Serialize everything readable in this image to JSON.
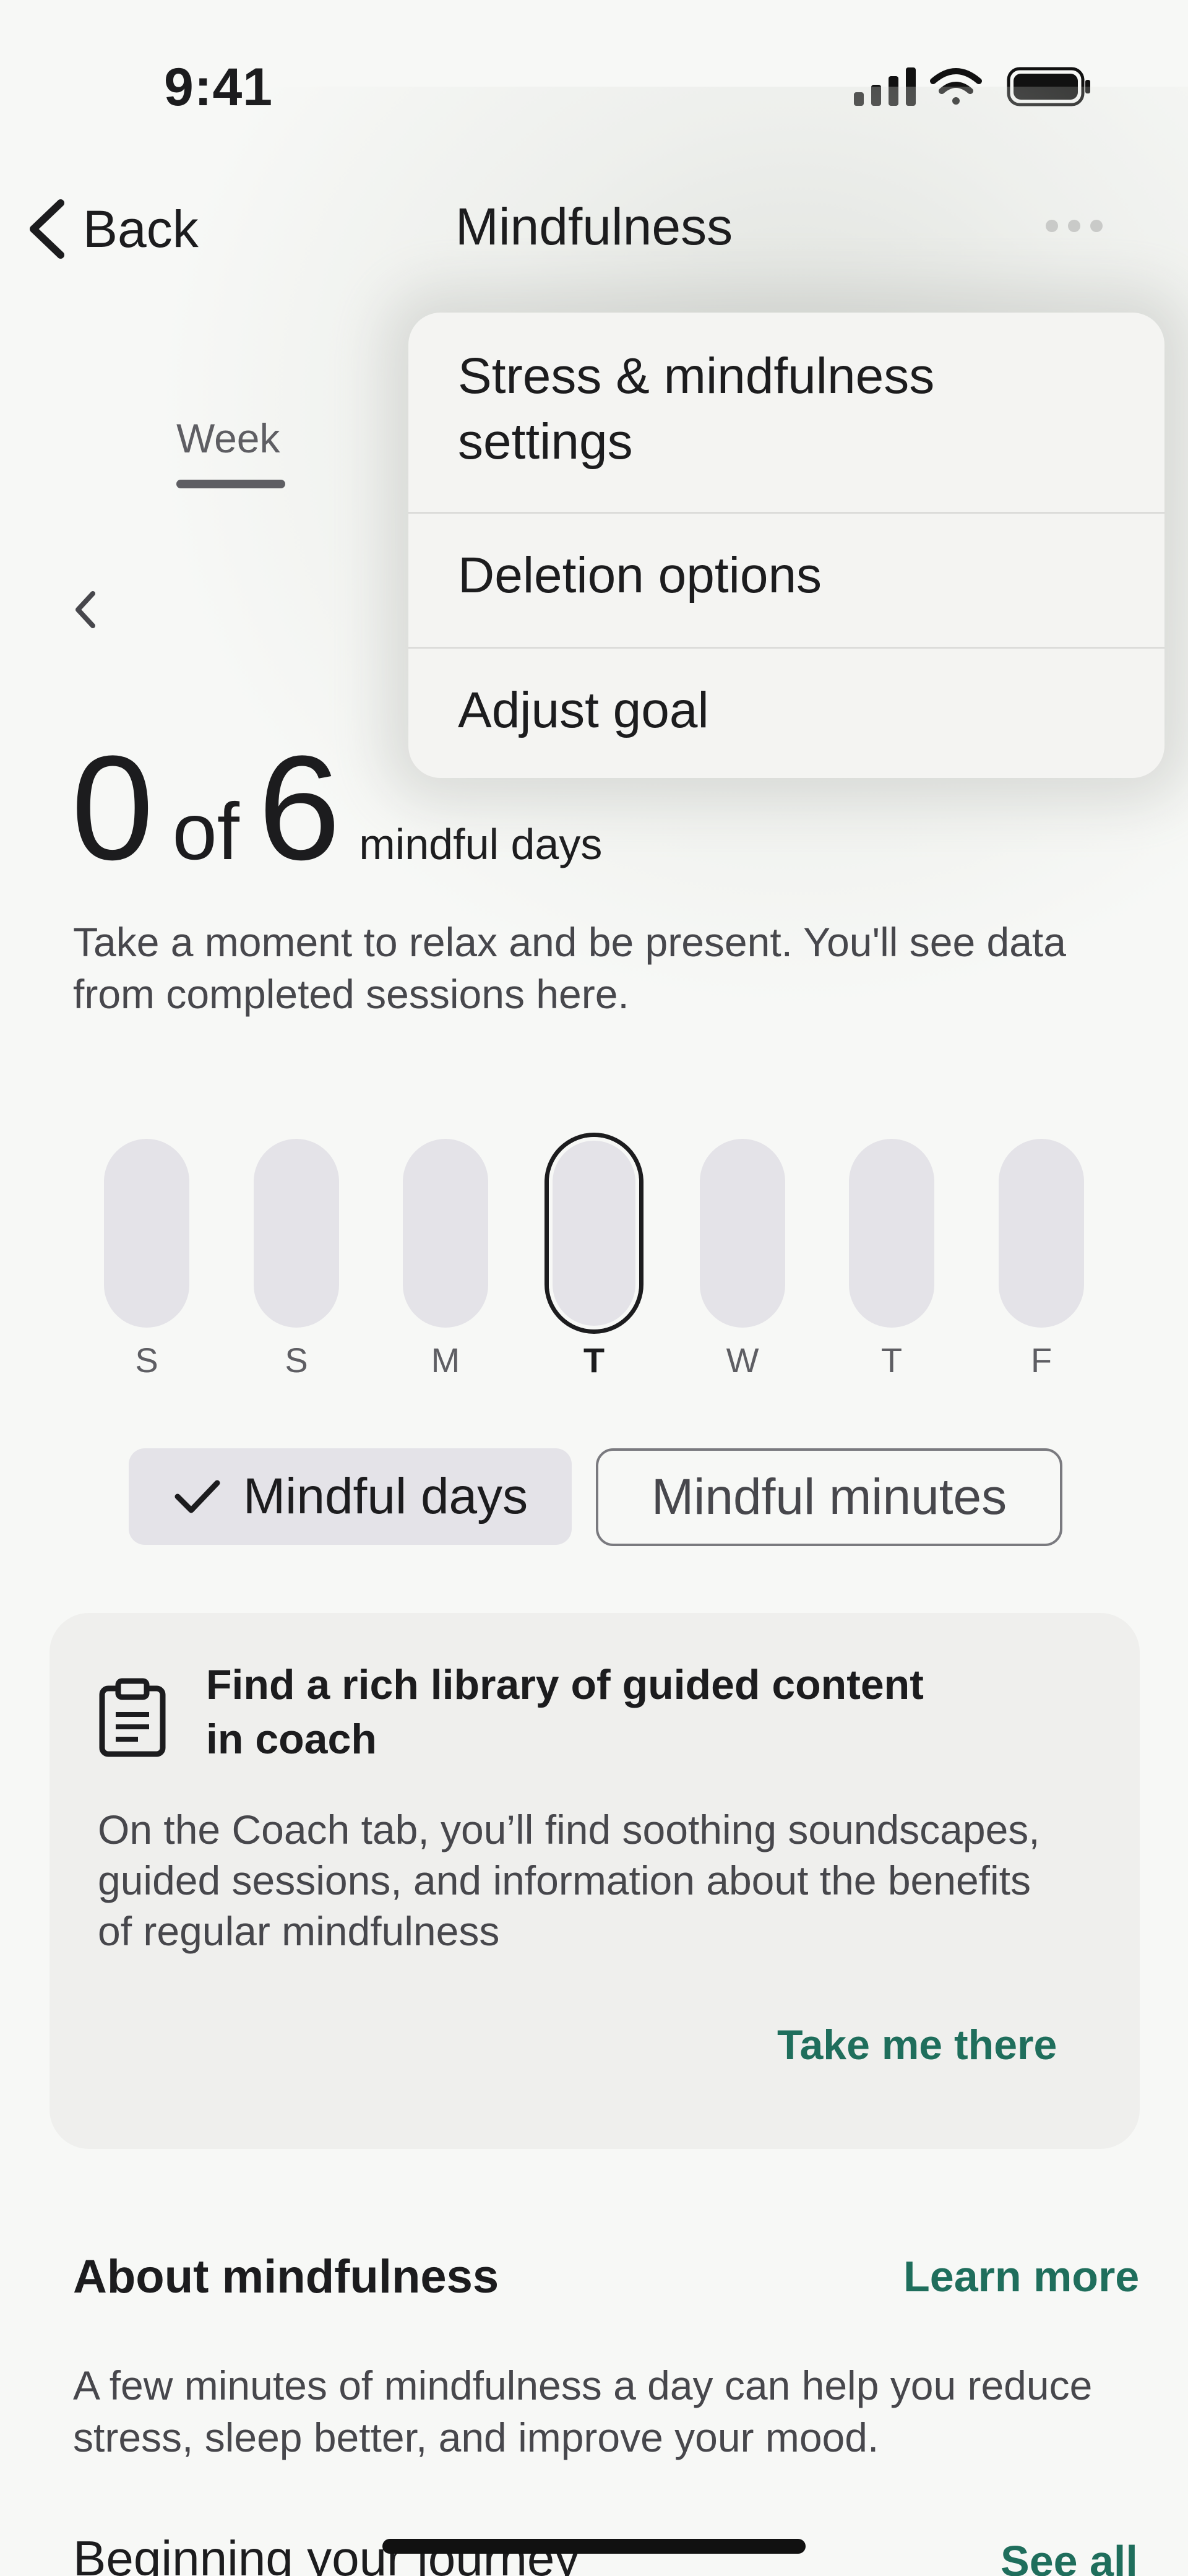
{
  "status_bar": {
    "time": "9:41"
  },
  "nav": {
    "back_label": "Back",
    "title": "Mindfulness"
  },
  "tabs": {
    "week_label": "Week"
  },
  "menu": {
    "items": [
      {
        "label": "Stress & mindfulness settings"
      },
      {
        "label": "Deletion options"
      },
      {
        "label": "Adjust goal"
      }
    ]
  },
  "stat": {
    "count": "0",
    "of": "of",
    "goal": "6",
    "unit": "mindful days"
  },
  "description": "Take a moment to relax and be present. You'll see data from completed sessions here.",
  "days": [
    {
      "label": "S",
      "today": false
    },
    {
      "label": "S",
      "today": false
    },
    {
      "label": "M",
      "today": false
    },
    {
      "label": "T",
      "today": true
    },
    {
      "label": "W",
      "today": false
    },
    {
      "label": "T",
      "today": false
    },
    {
      "label": "F",
      "today": false
    }
  ],
  "chips": {
    "active_label": "Mindful days",
    "inactive_label": "Mindful minutes"
  },
  "card": {
    "title": "Find a rich library of guided content in coach",
    "body": "On the Coach tab, you’ll find soothing soundscapes, guided sessions, and information about the benefits of regular mindfulness",
    "link": "Take me there",
    "icon": "clipboard-icon"
  },
  "about": {
    "title": "About mindfulness",
    "link": "Learn more",
    "body": "A few minutes of mindfulness a day can help you reduce stress, sleep better, and improve your mood."
  },
  "journey": {
    "title": "Beginning your journey",
    "link": "See all"
  },
  "colors": {
    "accent": "#1f6e5c",
    "pill": "#e4e3e8",
    "background": "#f7f8f6"
  }
}
